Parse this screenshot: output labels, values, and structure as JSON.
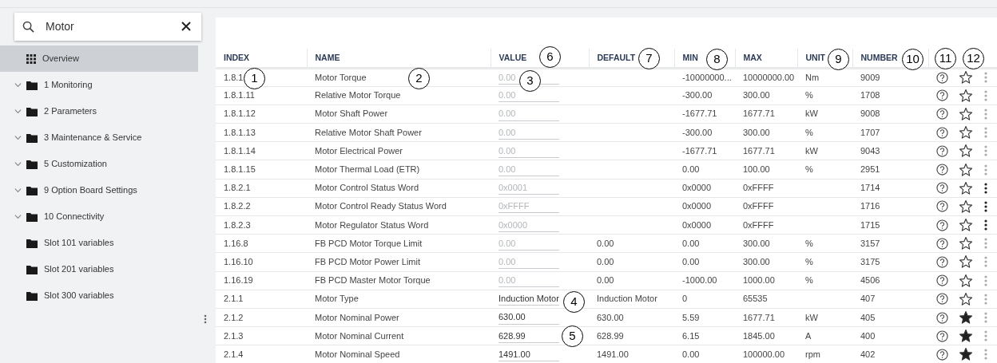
{
  "search": {
    "value": "Motor"
  },
  "sidebar": {
    "items": [
      {
        "kind": "overview",
        "label": "Overview",
        "selected": true
      },
      {
        "kind": "group",
        "label": "1 Monitoring",
        "selected": false
      },
      {
        "kind": "group",
        "label": "2 Parameters",
        "selected": false
      },
      {
        "kind": "group",
        "label": "3 Maintenance & Service",
        "selected": false
      },
      {
        "kind": "group",
        "label": "5 Customization",
        "selected": false
      },
      {
        "kind": "group",
        "label": "9 Option Board Settings",
        "selected": false
      },
      {
        "kind": "group",
        "label": "10 Connectivity",
        "selected": false
      },
      {
        "kind": "leaf",
        "label": "Slot 101 variables",
        "selected": false
      },
      {
        "kind": "leaf",
        "label": "Slot 201 variables",
        "selected": false
      },
      {
        "kind": "leaf",
        "label": "Slot 300 variables",
        "selected": false
      }
    ]
  },
  "table": {
    "columns": [
      "INDEX",
      "NAME",
      "VALUE",
      "DEFAULT",
      "MIN",
      "MAX",
      "UNIT",
      "NUMBER"
    ],
    "rows": [
      {
        "index": "1.8.1",
        "name": "Motor Torque",
        "value": "0.00",
        "editable": false,
        "default": "",
        "min": "-10000000...",
        "max": "10000000.00",
        "unit": "Nm",
        "number": "9009",
        "favorite": false,
        "menu_highlighted": false
      },
      {
        "index": "1.8.1.11",
        "name": "Relative Motor Torque",
        "value": "0.00",
        "editable": false,
        "default": "",
        "min": "-300.00",
        "max": "300.00",
        "unit": "%",
        "number": "1708",
        "favorite": false,
        "menu_highlighted": false
      },
      {
        "index": "1.8.1.12",
        "name": "Motor Shaft Power",
        "value": "0.00",
        "editable": false,
        "default": "",
        "min": "-1677.71",
        "max": "1677.71",
        "unit": "kW",
        "number": "9008",
        "favorite": false,
        "menu_highlighted": false
      },
      {
        "index": "1.8.1.13",
        "name": "Relative Motor Shaft Power",
        "value": "0.00",
        "editable": false,
        "default": "",
        "min": "-300.00",
        "max": "300.00",
        "unit": "%",
        "number": "1707",
        "favorite": false,
        "menu_highlighted": false
      },
      {
        "index": "1.8.1.14",
        "name": "Motor Electrical Power",
        "value": "0.00",
        "editable": false,
        "default": "",
        "min": "-1677.71",
        "max": "1677.71",
        "unit": "kW",
        "number": "9043",
        "favorite": false,
        "menu_highlighted": false
      },
      {
        "index": "1.8.1.15",
        "name": "Motor Thermal Load (ETR)",
        "value": "0.00",
        "editable": false,
        "default": "",
        "min": "0.00",
        "max": "100.00",
        "unit": "%",
        "number": "2951",
        "favorite": false,
        "menu_highlighted": false
      },
      {
        "index": "1.8.2.1",
        "name": "Motor Control Status Word",
        "value": "0x0001",
        "editable": false,
        "default": "",
        "min": "0x0000",
        "max": "0xFFFF",
        "unit": "",
        "number": "1714",
        "favorite": false,
        "menu_highlighted": true
      },
      {
        "index": "1.8.2.2",
        "name": "Motor Control Ready Status Word",
        "value": "0xFFFF",
        "editable": false,
        "default": "",
        "min": "0x0000",
        "max": "0xFFFF",
        "unit": "",
        "number": "1716",
        "favorite": false,
        "menu_highlighted": true
      },
      {
        "index": "1.8.2.3",
        "name": "Motor Regulator Status Word",
        "value": "0x0000",
        "editable": false,
        "default": "",
        "min": "0x0000",
        "max": "0xFFFF",
        "unit": "",
        "number": "1715",
        "favorite": false,
        "menu_highlighted": true
      },
      {
        "index": "1.16.8",
        "name": "FB PCD Motor Torque Limit",
        "value": "0.00",
        "editable": false,
        "default": "0.00",
        "min": "0.00",
        "max": "300.00",
        "unit": "%",
        "number": "3157",
        "favorite": false,
        "menu_highlighted": false
      },
      {
        "index": "1.16.10",
        "name": "FB PCD Motor Power Limit",
        "value": "0.00",
        "editable": false,
        "default": "0.00",
        "min": "0.00",
        "max": "300.00",
        "unit": "%",
        "number": "3175",
        "favorite": false,
        "menu_highlighted": false
      },
      {
        "index": "1.16.19",
        "name": "FB PCD Master Motor Torque",
        "value": "0.00",
        "editable": false,
        "default": "0.00",
        "min": "-1000.00",
        "max": "1000.00",
        "unit": "%",
        "number": "4506",
        "favorite": false,
        "menu_highlighted": false
      },
      {
        "index": "2.1.1",
        "name": "Motor Type",
        "value": "Induction Motor",
        "editable": true,
        "default": "Induction Motor",
        "min": "0",
        "max": "65535",
        "unit": "",
        "number": "407",
        "favorite": false,
        "menu_highlighted": false
      },
      {
        "index": "2.1.2",
        "name": "Motor Nominal Power",
        "value": "630.00",
        "editable": true,
        "default": "630.00",
        "min": "5.59",
        "max": "1677.71",
        "unit": "kW",
        "number": "405",
        "favorite": true,
        "menu_highlighted": false
      },
      {
        "index": "2.1.3",
        "name": "Motor Nominal Current",
        "value": "628.99",
        "editable": true,
        "default": "628.99",
        "min": "6.15",
        "max": "1845.00",
        "unit": "A",
        "number": "400",
        "favorite": true,
        "menu_highlighted": false
      },
      {
        "index": "2.1.4",
        "name": "Motor Nominal Speed",
        "value": "1491.00",
        "editable": true,
        "default": "1491.00",
        "min": "0.00",
        "max": "100000.00",
        "unit": "rpm",
        "number": "402",
        "favorite": true,
        "menu_highlighted": false
      }
    ]
  },
  "callouts": [
    "1",
    "2",
    "3",
    "4",
    "5",
    "6",
    "7",
    "8",
    "9",
    "10",
    "11",
    "12"
  ]
}
